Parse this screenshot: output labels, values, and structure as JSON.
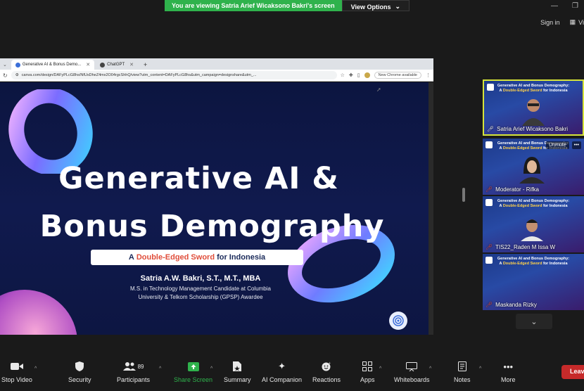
{
  "banner": {
    "text": "You are viewing Satria Arief Wicaksono Bakri's screen",
    "view_options": "View Options"
  },
  "topbar": {
    "sign_in": "Sign in",
    "view": "Vi"
  },
  "browser": {
    "tabs": [
      {
        "label": "Generative AI & Bonus Demo..."
      },
      {
        "label": "ChatGPT"
      }
    ],
    "url": "canva.com/design/DAFyPLcG8hs/NfUsDheZ4mx2O04rgcShhQ/view?utm_content=DAFyPLcG8hs&utm_campaign=designshare&utm_...",
    "new_chrome": "New Chrome available"
  },
  "slide": {
    "title_line1": "Generative AI &",
    "title_line2": "Bonus Demography",
    "subtitle_pre": "A",
    "subtitle_highlight": "Double-Edged Sword",
    "subtitle_post": "for Indonesia",
    "presenter_name": "Satria A.W. Bakri, S.T., M.T., MBA",
    "presenter_line1": "M.S. in Technology Management Candidate at Columbia",
    "presenter_line2": "University & Telkom Scholarship (GPSP) Awardee"
  },
  "tile_header": {
    "line1": "Generative AI and Bonus Demography:",
    "line2_pre": "A",
    "line2_highlight": "Double-Edged Sword",
    "line2_post": "for Indonesia"
  },
  "participants": [
    {
      "name": "Satria Arief Wicaksono Bakri",
      "muted": false
    },
    {
      "name": "Moderator - Rifka",
      "muted": true,
      "unmute_label": "Unmute"
    },
    {
      "name": "TIS22_Raden M Issa W",
      "muted": true
    },
    {
      "name": "Maskanda Rizky",
      "muted": true
    }
  ],
  "toolbar": {
    "stop_video": "Stop Video",
    "security": "Security",
    "participants": "Participants",
    "participants_count": "89",
    "share_screen": "Share Screen",
    "summary": "Summary",
    "ai_companion": "AI Companion",
    "reactions": "Reactions",
    "apps": "Apps",
    "whiteboards": "Whiteboards",
    "notes": "Notes",
    "more": "More",
    "leave": "Leave"
  }
}
